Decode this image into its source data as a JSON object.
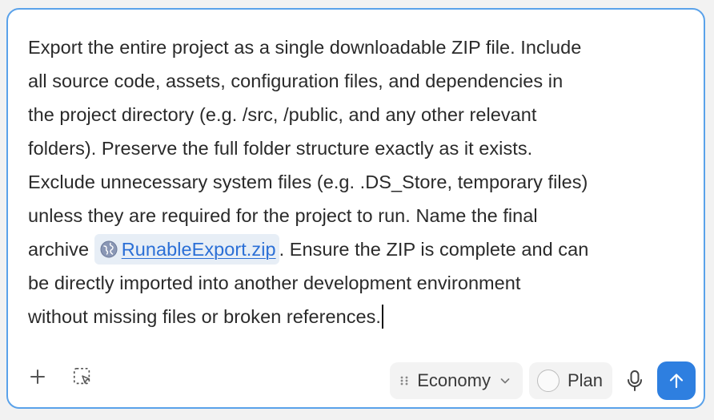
{
  "prompt": {
    "line1": "Export the entire project as a single downloadable ZIP file. Include",
    "line2": "all source code, assets, configuration files, and dependencies in",
    "line3": "the project directory (e.g. /src, /public, and any other relevant",
    "line4": "folders). Preserve the full folder structure exactly as it exists.",
    "line5": "Exclude unnecessary system files (e.g. .DS_Store, temporary files)",
    "line6": "unless they are required for the project to run. Name the final",
    "line7_before": "archive",
    "file_chip": {
      "icon": "globe-icon",
      "filename": "RunableExport.zip"
    },
    "line7_after": ". Ensure the ZIP is complete and can",
    "line8": "be directly imported into another development environment",
    "line9": "without missing files or broken references."
  },
  "toolbar": {
    "add_icon": "plus-icon",
    "select_icon": "area-select-icon",
    "model": {
      "icon": "drag-dots-icon",
      "label": "Economy",
      "chevron": "chevron-down-icon"
    },
    "plan": {
      "label": "Plan",
      "enabled": false
    },
    "mic_icon": "microphone-icon",
    "send_icon": "arrow-up-icon"
  },
  "colors": {
    "accent": "#2e7fe0",
    "border": "#5aa2ea",
    "link": "#2b6fd6",
    "chip_bg": "#e7eef6"
  }
}
